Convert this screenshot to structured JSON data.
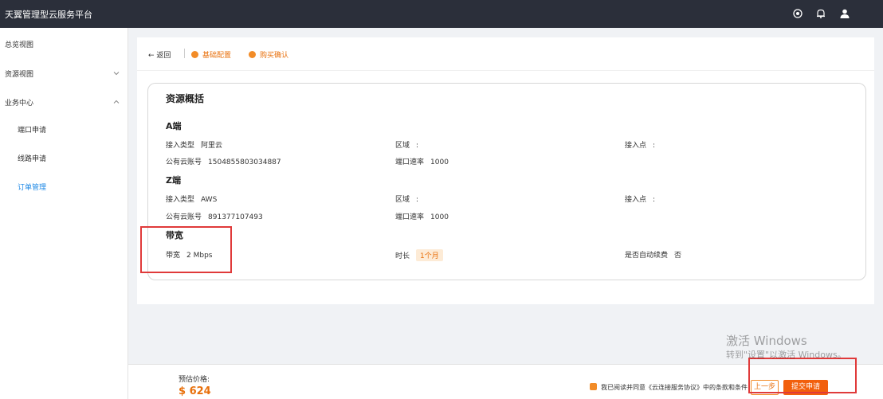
{
  "app": {
    "title": "天翼管理型云服务平台"
  },
  "icons": {
    "top": [
      "target-icon",
      "bell-icon",
      "user-icon"
    ]
  },
  "sidebar": {
    "items": [
      {
        "label": "总览视图"
      },
      {
        "label": "资源视图"
      },
      {
        "label": "业务中心"
      },
      {
        "label": "端口申请"
      },
      {
        "label": "线路申请"
      },
      {
        "label": "订单管理"
      }
    ]
  },
  "header": {
    "back": "返回",
    "steps": [
      "基础配置",
      "购买确认"
    ]
  },
  "summary": {
    "title": "资源概括",
    "a_end": {
      "heading": "A端",
      "access_type_label": "接入类型",
      "access_type_value": "阿里云",
      "region_label": "区域",
      "region_value": ":",
      "access_point_label": "接入点",
      "access_point_value": ":",
      "account_label": "公有云账号",
      "account_value": "1504855803034887",
      "speed_label": "端口速率",
      "speed_value": "1000"
    },
    "z_end": {
      "heading": "Z端",
      "access_type_label": "接入类型",
      "access_type_value": "AWS",
      "region_label": "区域",
      "region_value": ":",
      "access_point_label": "接入点",
      "access_point_value": ":",
      "account_label": "公有云账号",
      "account_value": "891377107493",
      "speed_label": "端口速率",
      "speed_value": "1000"
    },
    "bandwidth": {
      "heading": "带宽",
      "bw_label": "带宽",
      "bw_value": "2 Mbps",
      "duration_label": "时长",
      "duration_value": "1个月",
      "renew_label": "是否自动续费",
      "renew_value": "否"
    }
  },
  "footer": {
    "price_label": "预估价格:",
    "price": "$ 624",
    "agree_text": "我已阅读并同意《云连接服务协议》中的条款和条件",
    "prev": "上一步",
    "submit": "提交申请"
  },
  "watermark": {
    "line1": "激活 Windows",
    "line2": "转到\"设置\"以激活 Windows。"
  },
  "colors": {
    "topbar": "#2b2f3a",
    "accent": "#f28c28",
    "submit": "#f25f0c",
    "highlight": "#e03a3a",
    "active": "#1e88e5"
  }
}
